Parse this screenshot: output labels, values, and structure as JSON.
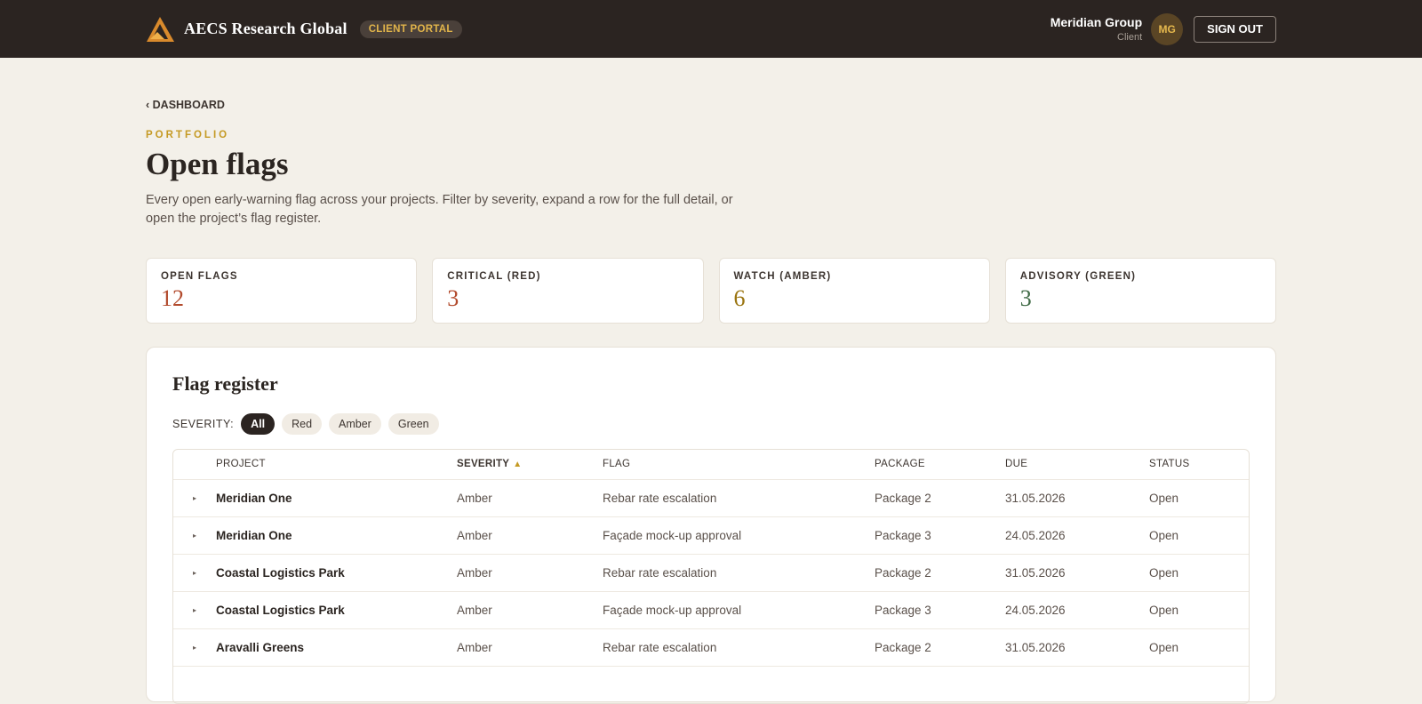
{
  "header": {
    "brand": "AECS Research Global",
    "badge": "CLIENT PORTAL",
    "user_name": "Meridian Group",
    "user_role": "Client",
    "avatar_initials": "MG",
    "signout_label": "SIGN OUT"
  },
  "page": {
    "back_label": "‹ DASHBOARD",
    "eyebrow": "PORTFOLIO",
    "title": "Open flags",
    "description": "Every open early-warning flag across your projects. Filter by severity, expand a row for the full detail, or open the project’s flag register."
  },
  "stats": [
    {
      "label": "OPEN FLAGS",
      "value": "12",
      "color": "#b24a2c"
    },
    {
      "label": "CRITICAL (RED)",
      "value": "3",
      "color": "#b24a2c"
    },
    {
      "label": "WATCH (AMBER)",
      "value": "6",
      "color": "#9a7410"
    },
    {
      "label": "ADVISORY (GREEN)",
      "value": "3",
      "color": "#3f6a45"
    }
  ],
  "register": {
    "title": "Flag register",
    "filter_label": "SEVERITY:",
    "filters": [
      "All",
      "Red",
      "Amber",
      "Green"
    ],
    "active_filter": "All",
    "columns": [
      "PROJECT",
      "SEVERITY",
      "FLAG",
      "PACKAGE",
      "DUE",
      "STATUS"
    ],
    "sort_icon": "▲",
    "expand_icon": "▸",
    "rows": [
      {
        "project": "Meridian One",
        "severity": "Amber",
        "flag": "Rebar rate escalation",
        "package": "Package 2",
        "due": "31.05.2026",
        "status": "Open"
      },
      {
        "project": "Meridian One",
        "severity": "Amber",
        "flag": "Façade mock-up approval",
        "package": "Package 3",
        "due": "24.05.2026",
        "status": "Open"
      },
      {
        "project": "Coastal Logistics Park",
        "severity": "Amber",
        "flag": "Rebar rate escalation",
        "package": "Package 2",
        "due": "31.05.2026",
        "status": "Open"
      },
      {
        "project": "Coastal Logistics Park",
        "severity": "Amber",
        "flag": "Façade mock-up approval",
        "package": "Package 3",
        "due": "24.05.2026",
        "status": "Open"
      },
      {
        "project": "Aravalli Greens",
        "severity": "Amber",
        "flag": "Rebar rate escalation",
        "package": "Package 2",
        "due": "31.05.2026",
        "status": "Open"
      }
    ]
  },
  "colors": {
    "accent": "#c59a24",
    "topbar": "#2b2421",
    "background": "#f3f0e9"
  }
}
